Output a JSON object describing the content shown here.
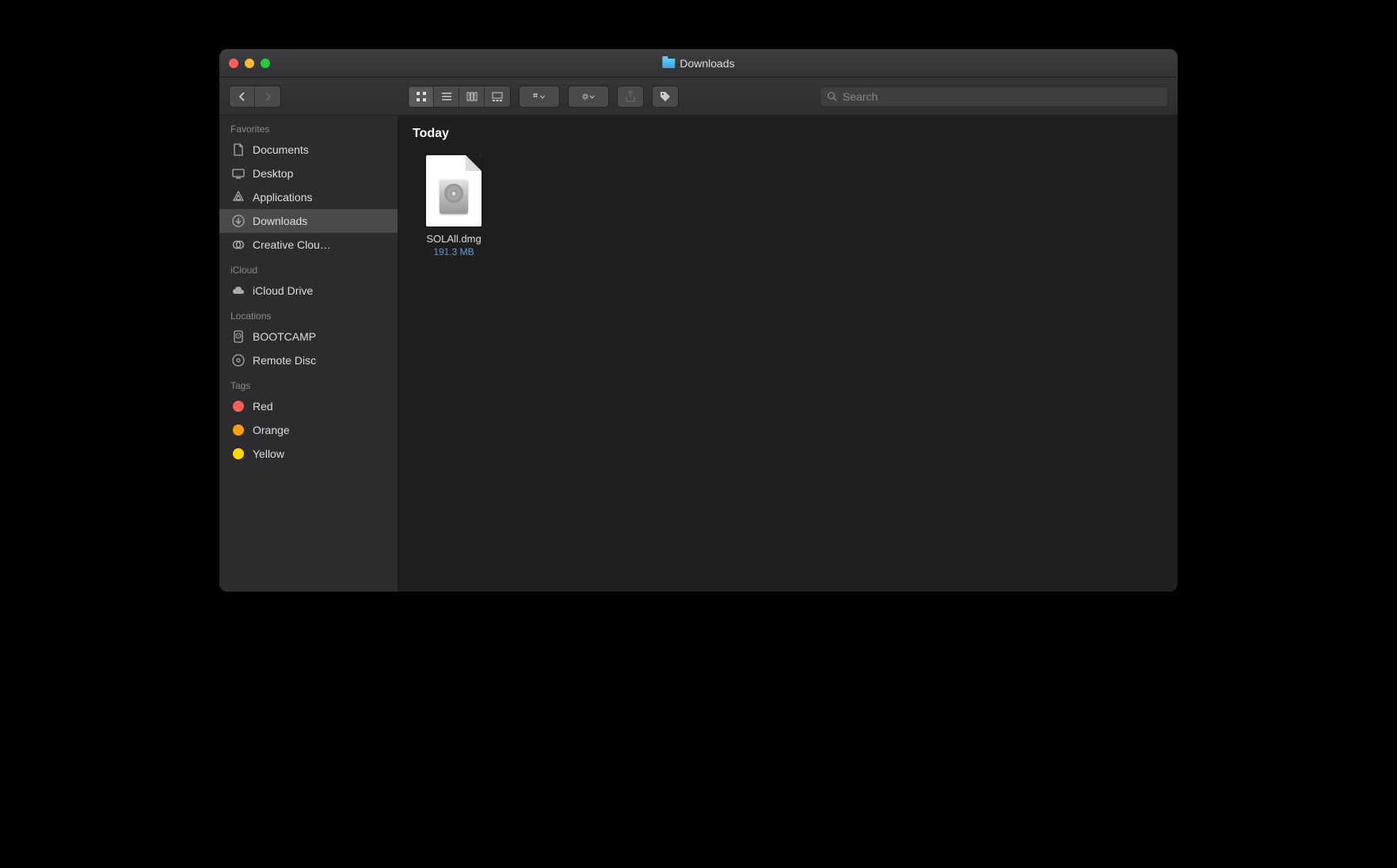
{
  "window": {
    "title": "Downloads"
  },
  "toolbar": {
    "search_placeholder": "Search"
  },
  "sidebar": {
    "sections": [
      {
        "header": "Favorites",
        "items": [
          {
            "label": "Documents",
            "icon": "doc-icon",
            "selected": false
          },
          {
            "label": "Desktop",
            "icon": "desktop-icon",
            "selected": false
          },
          {
            "label": "Applications",
            "icon": "apps-icon",
            "selected": false
          },
          {
            "label": "Downloads",
            "icon": "downloads-icon",
            "selected": true
          },
          {
            "label": "Creative Clou…",
            "icon": "cc-icon",
            "selected": false
          }
        ]
      },
      {
        "header": "iCloud",
        "items": [
          {
            "label": "iCloud Drive",
            "icon": "cloud-icon",
            "selected": false
          }
        ]
      },
      {
        "header": "Locations",
        "items": [
          {
            "label": "BOOTCAMP",
            "icon": "hdd-icon",
            "selected": false
          },
          {
            "label": "Remote Disc",
            "icon": "disc-icon",
            "selected": false
          }
        ]
      },
      {
        "header": "Tags",
        "items": [
          {
            "label": "Red",
            "color": "#ff5f57"
          },
          {
            "label": "Orange",
            "color": "#ff9f0a"
          },
          {
            "label": "Yellow",
            "color": "#ffd60a"
          }
        ]
      }
    ]
  },
  "content": {
    "group_header": "Today",
    "files": [
      {
        "name": "SOLAll.dmg",
        "size": "191.3 MB",
        "kind": "dmg"
      }
    ]
  }
}
